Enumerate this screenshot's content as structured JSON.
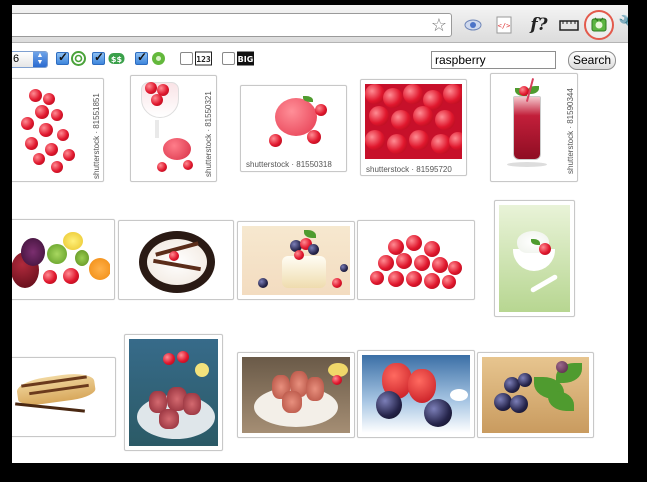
{
  "toolbar": {
    "icons": [
      "star-icon",
      "extension-icon-1",
      "extension-icon-2",
      "extension-icon-fquestion",
      "extension-icon-4",
      "extension-icon-highlighted",
      "wrench-icon"
    ],
    "ext_fq_label": "f?",
    "highlight_color": "#e35a4c"
  },
  "controls": {
    "size_value": "6",
    "filters": [
      {
        "name": "filter-1",
        "checked": true
      },
      {
        "name": "filter-2",
        "checked": true
      },
      {
        "name": "filter-3",
        "checked": true
      },
      {
        "name": "filter-123",
        "checked": false,
        "label": "123"
      },
      {
        "name": "filter-big",
        "checked": false,
        "label": "BIG"
      }
    ],
    "search_value": "raspberry",
    "search_button": "Search"
  },
  "thumbnails": {
    "row1": [
      {
        "caption": "shutterstock · 81551851"
      },
      {
        "caption": "shutterstock · 81550321"
      },
      {
        "caption": "shutterstock · 81550318"
      },
      {
        "caption": "shutterstock · 81595720"
      },
      {
        "caption": "shutterstock · 81590344"
      }
    ]
  }
}
